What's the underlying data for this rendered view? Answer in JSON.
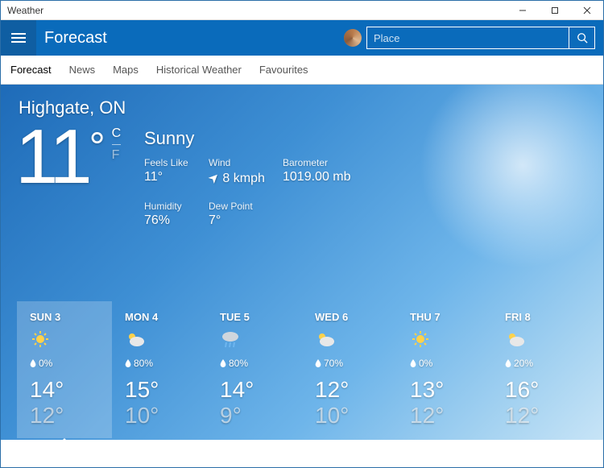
{
  "window": {
    "title": "Weather"
  },
  "header": {
    "title": "Forecast"
  },
  "search": {
    "placeholder": "Place"
  },
  "nav": {
    "tabs": [
      {
        "label": "Forecast",
        "active": true
      },
      {
        "label": "News"
      },
      {
        "label": "Maps"
      },
      {
        "label": "Historical Weather"
      },
      {
        "label": "Favourites"
      }
    ]
  },
  "location": "Highgate, ON",
  "current": {
    "temp": "11",
    "deg": "°",
    "unit_c": "C",
    "unit_f": "F",
    "condition": "Sunny",
    "details": {
      "feels_label": "Feels Like",
      "feels_val": "11°",
      "wind_label": "Wind",
      "wind_val": "8 kmph",
      "baro_label": "Barometer",
      "baro_val": "1019.00 mb",
      "hum_label": "Humidity",
      "hum_val": "76%",
      "dew_label": "Dew Point",
      "dew_val": "7°"
    }
  },
  "forecast": [
    {
      "name": "SUN 3",
      "icon": "sun",
      "precip": "0%",
      "hi": "14°",
      "lo": "12°",
      "sel": true
    },
    {
      "name": "MON 4",
      "icon": "partly",
      "precip": "80%",
      "hi": "15°",
      "lo": "10°"
    },
    {
      "name": "TUE 5",
      "icon": "rain",
      "precip": "80%",
      "hi": "14°",
      "lo": "9°"
    },
    {
      "name": "WED 6",
      "icon": "partly",
      "precip": "70%",
      "hi": "12°",
      "lo": "10°"
    },
    {
      "name": "THU 7",
      "icon": "sun",
      "precip": "0%",
      "hi": "13°",
      "lo": "12°"
    },
    {
      "name": "FRI 8",
      "icon": "partly",
      "precip": "20%",
      "hi": "16°",
      "lo": "12°"
    }
  ]
}
